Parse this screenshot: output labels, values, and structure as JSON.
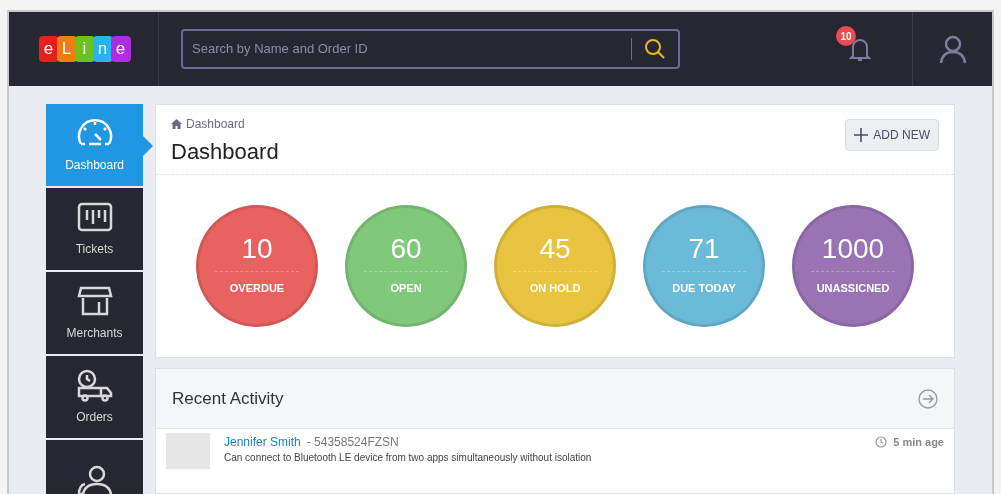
{
  "logo": {
    "letters": [
      {
        "char": "e",
        "color": "#e8201c"
      },
      {
        "char": "L",
        "color": "#f07c14"
      },
      {
        "char": "i",
        "color": "#6cc21c"
      },
      {
        "char": "n",
        "color": "#25b4ec"
      },
      {
        "char": "e",
        "color": "#b02ce0"
      }
    ]
  },
  "search": {
    "placeholder": "Search by Name and Order ID"
  },
  "notifications": {
    "count": "10"
  },
  "sidebar": {
    "items": [
      {
        "kind": "gauge",
        "label": "Dashboard",
        "selected": true
      },
      {
        "kind": "ticket",
        "label": "Tickets",
        "selected": false
      },
      {
        "kind": "store",
        "label": "Merchants",
        "selected": false
      },
      {
        "kind": "truck",
        "label": "Orders",
        "selected": false
      },
      {
        "kind": "users",
        "selected": false
      }
    ]
  },
  "breadcrumb": "Dashboard",
  "page_title": "Dashboard",
  "add_button": "ADD NEW",
  "stats": [
    {
      "value": "10",
      "label": "OVERDUE",
      "color": "#e8635f"
    },
    {
      "value": "60",
      "label": "OPEN",
      "color": "#80c97b"
    },
    {
      "value": "45",
      "label": "ON HOLD",
      "color": "#e8c440"
    },
    {
      "value": "71",
      "label": "DUE TODAY",
      "color": "#6bbbd8"
    },
    {
      "value": "1000",
      "label": "UNASSICNED",
      "color": "#9a73b5"
    }
  ],
  "recent_activity": {
    "title": "Recent Activity",
    "items": [
      {
        "name": "Jennifer Smith",
        "order": "- 54358524FZSN",
        "time": "5 min age",
        "text": "Can connect to Bluetooth LE device from two apps simultaneously without isolation"
      }
    ]
  }
}
